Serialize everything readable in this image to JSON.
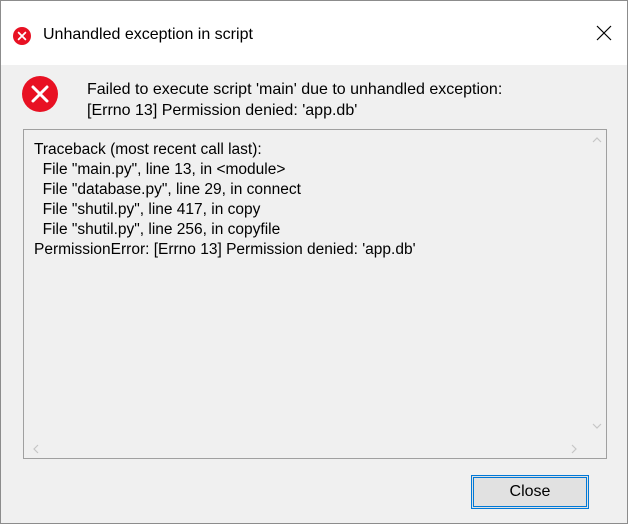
{
  "window": {
    "title": "Unhandled exception in script"
  },
  "message": {
    "line1": "Failed to execute script 'main' due to unhandled exception:",
    "line2": "[Errno 13] Permission denied: 'app.db'"
  },
  "traceback": {
    "text": "Traceback (most recent call last):\n  File \"main.py\", line 13, in <module>\n  File \"database.py\", line 29, in connect\n  File \"shutil.py\", line 417, in copy\n  File \"shutil.py\", line 256, in copyfile\nPermissionError: [Errno 13] Permission denied: 'app.db'"
  },
  "buttons": {
    "close_label": "Close"
  },
  "colors": {
    "error_red": "#e81123",
    "focus_blue": "#0078d7"
  },
  "icons": {
    "title_icon": "error-icon",
    "message_icon": "error-icon",
    "window_close": "close-icon"
  }
}
